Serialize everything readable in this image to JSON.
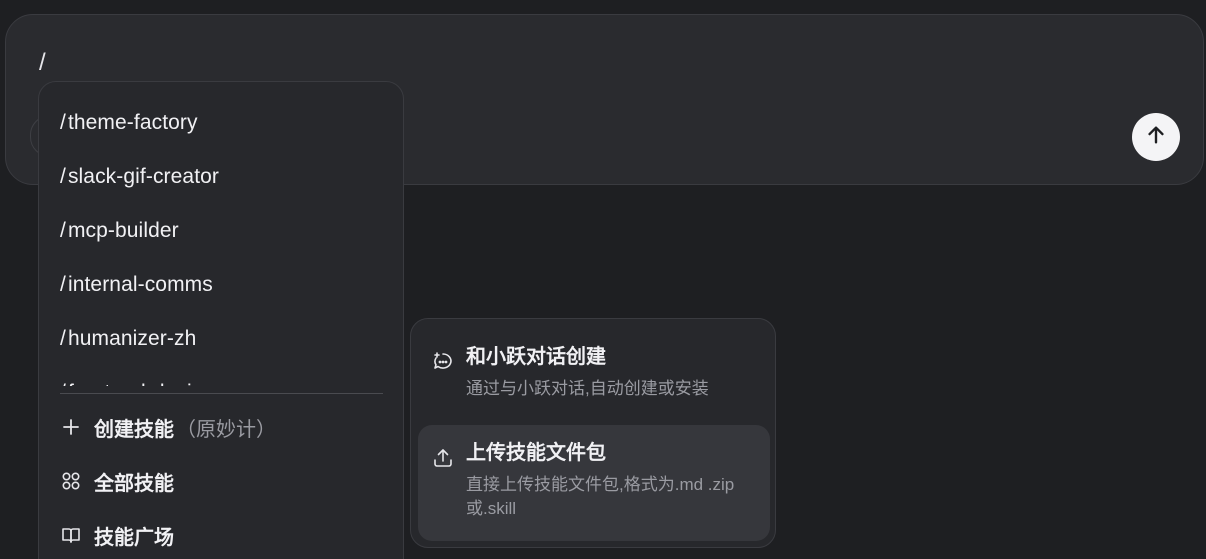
{
  "composer": {
    "input_value": "/"
  },
  "slash_menu": {
    "commands": [
      {
        "slash": "/",
        "name": "theme-factory"
      },
      {
        "slash": "/",
        "name": "slack-gif-creator"
      },
      {
        "slash": "/",
        "name": "mcp-builder"
      },
      {
        "slash": "/",
        "name": "internal-comms"
      },
      {
        "slash": "/",
        "name": "humanizer-zh"
      },
      {
        "slash": "/",
        "name": "frontend-design"
      }
    ],
    "actions": {
      "create_label": "创建技能",
      "create_note": "（原妙计）",
      "all_label": "全部技能",
      "plaza_label": "技能广场"
    }
  },
  "submenu": {
    "chat_create": {
      "title": "和小跃对话创建",
      "desc": "通过与小跃对话,自动创建或安装"
    },
    "upload": {
      "title": "上传技能文件包",
      "desc": "直接上传技能文件包,格式为.md .zip或.skill"
    }
  }
}
